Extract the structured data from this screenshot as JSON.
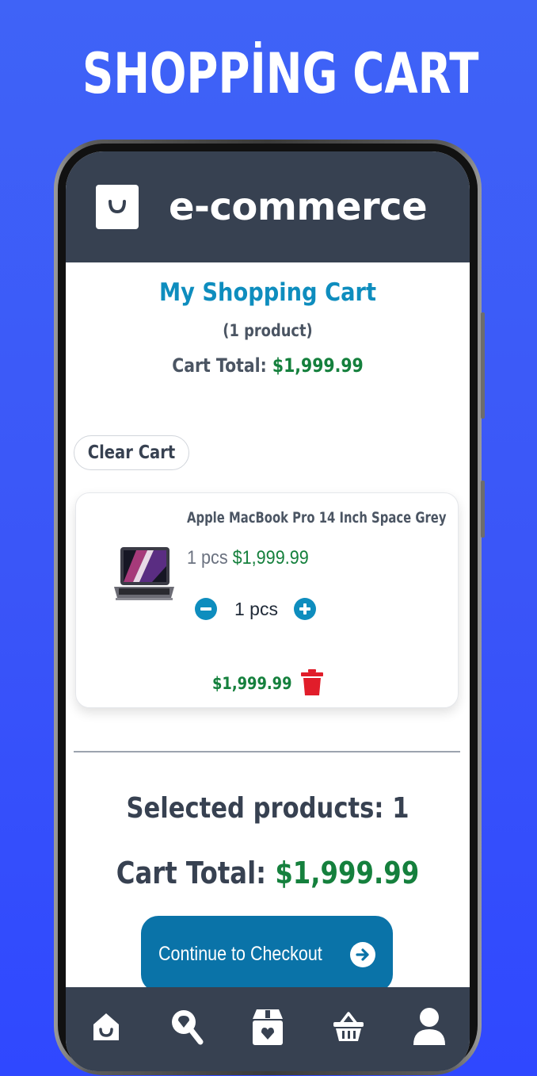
{
  "promo": {
    "title": "SHOPPİNG CART"
  },
  "header": {
    "brand": "e-commerce",
    "logo_icon": "shopping-bag-icon"
  },
  "cart": {
    "title": "My Shopping Cart",
    "count_text": "(1 product)",
    "total_label": "Cart Total:",
    "total_value": "$1,999.99",
    "clear_label": "Clear Cart"
  },
  "item": {
    "name": "Apple MacBook Pro 14 Inch Space Grey",
    "unit_qty": "1 pcs",
    "unit_price": "$1,999.99",
    "qty": "1 pcs",
    "line_total": "$1,999.99",
    "image_icon": "laptop-image"
  },
  "summary": {
    "selected_label": "Selected products: 1",
    "total_label": "Cart Total:",
    "total_value": "$1,999.99",
    "checkout_label": "Continue to Checkout"
  },
  "nav": [
    "home-icon",
    "search-icon",
    "store-icon",
    "basket-icon",
    "profile-icon"
  ],
  "colors": {
    "accent": "#0e8dbe",
    "price": "#15803d",
    "header": "#374151",
    "danger": "#e11d2a",
    "background": "#3a55f8"
  }
}
